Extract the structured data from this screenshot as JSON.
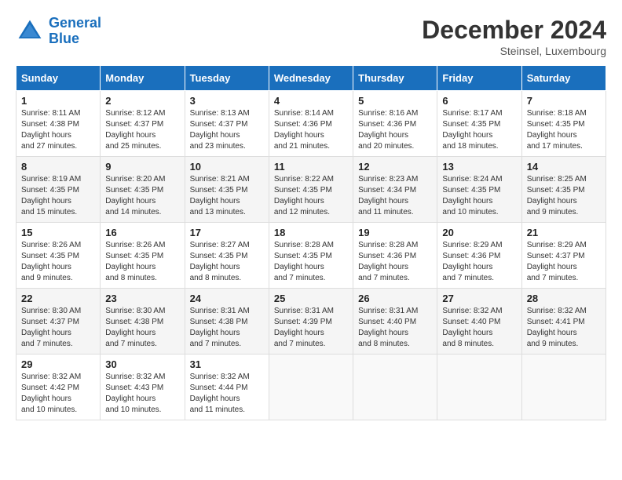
{
  "logo": {
    "line1": "General",
    "line2": "Blue"
  },
  "title": "December 2024",
  "subtitle": "Steinsel, Luxembourg",
  "days_header": [
    "Sunday",
    "Monday",
    "Tuesday",
    "Wednesday",
    "Thursday",
    "Friday",
    "Saturday"
  ],
  "weeks": [
    [
      {
        "day": "1",
        "sunrise": "8:11 AM",
        "sunset": "4:38 PM",
        "daylight": "8 hours and 27 minutes."
      },
      {
        "day": "2",
        "sunrise": "8:12 AM",
        "sunset": "4:37 PM",
        "daylight": "8 hours and 25 minutes."
      },
      {
        "day": "3",
        "sunrise": "8:13 AM",
        "sunset": "4:37 PM",
        "daylight": "8 hours and 23 minutes."
      },
      {
        "day": "4",
        "sunrise": "8:14 AM",
        "sunset": "4:36 PM",
        "daylight": "8 hours and 21 minutes."
      },
      {
        "day": "5",
        "sunrise": "8:16 AM",
        "sunset": "4:36 PM",
        "daylight": "8 hours and 20 minutes."
      },
      {
        "day": "6",
        "sunrise": "8:17 AM",
        "sunset": "4:35 PM",
        "daylight": "8 hours and 18 minutes."
      },
      {
        "day": "7",
        "sunrise": "8:18 AM",
        "sunset": "4:35 PM",
        "daylight": "8 hours and 17 minutes."
      }
    ],
    [
      {
        "day": "8",
        "sunrise": "8:19 AM",
        "sunset": "4:35 PM",
        "daylight": "8 hours and 15 minutes."
      },
      {
        "day": "9",
        "sunrise": "8:20 AM",
        "sunset": "4:35 PM",
        "daylight": "8 hours and 14 minutes."
      },
      {
        "day": "10",
        "sunrise": "8:21 AM",
        "sunset": "4:35 PM",
        "daylight": "8 hours and 13 minutes."
      },
      {
        "day": "11",
        "sunrise": "8:22 AM",
        "sunset": "4:35 PM",
        "daylight": "8 hours and 12 minutes."
      },
      {
        "day": "12",
        "sunrise": "8:23 AM",
        "sunset": "4:34 PM",
        "daylight": "8 hours and 11 minutes."
      },
      {
        "day": "13",
        "sunrise": "8:24 AM",
        "sunset": "4:35 PM",
        "daylight": "8 hours and 10 minutes."
      },
      {
        "day": "14",
        "sunrise": "8:25 AM",
        "sunset": "4:35 PM",
        "daylight": "8 hours and 9 minutes."
      }
    ],
    [
      {
        "day": "15",
        "sunrise": "8:26 AM",
        "sunset": "4:35 PM",
        "daylight": "8 hours and 9 minutes."
      },
      {
        "day": "16",
        "sunrise": "8:26 AM",
        "sunset": "4:35 PM",
        "daylight": "8 hours and 8 minutes."
      },
      {
        "day": "17",
        "sunrise": "8:27 AM",
        "sunset": "4:35 PM",
        "daylight": "8 hours and 8 minutes."
      },
      {
        "day": "18",
        "sunrise": "8:28 AM",
        "sunset": "4:35 PM",
        "daylight": "8 hours and 7 minutes."
      },
      {
        "day": "19",
        "sunrise": "8:28 AM",
        "sunset": "4:36 PM",
        "daylight": "8 hours and 7 minutes."
      },
      {
        "day": "20",
        "sunrise": "8:29 AM",
        "sunset": "4:36 PM",
        "daylight": "8 hours and 7 minutes."
      },
      {
        "day": "21",
        "sunrise": "8:29 AM",
        "sunset": "4:37 PM",
        "daylight": "8 hours and 7 minutes."
      }
    ],
    [
      {
        "day": "22",
        "sunrise": "8:30 AM",
        "sunset": "4:37 PM",
        "daylight": "8 hours and 7 minutes."
      },
      {
        "day": "23",
        "sunrise": "8:30 AM",
        "sunset": "4:38 PM",
        "daylight": "8 hours and 7 minutes."
      },
      {
        "day": "24",
        "sunrise": "8:31 AM",
        "sunset": "4:38 PM",
        "daylight": "8 hours and 7 minutes."
      },
      {
        "day": "25",
        "sunrise": "8:31 AM",
        "sunset": "4:39 PM",
        "daylight": "8 hours and 7 minutes."
      },
      {
        "day": "26",
        "sunrise": "8:31 AM",
        "sunset": "4:40 PM",
        "daylight": "8 hours and 8 minutes."
      },
      {
        "day": "27",
        "sunrise": "8:32 AM",
        "sunset": "4:40 PM",
        "daylight": "8 hours and 8 minutes."
      },
      {
        "day": "28",
        "sunrise": "8:32 AM",
        "sunset": "4:41 PM",
        "daylight": "8 hours and 9 minutes."
      }
    ],
    [
      {
        "day": "29",
        "sunrise": "8:32 AM",
        "sunset": "4:42 PM",
        "daylight": "8 hours and 10 minutes."
      },
      {
        "day": "30",
        "sunrise": "8:32 AM",
        "sunset": "4:43 PM",
        "daylight": "8 hours and 10 minutes."
      },
      {
        "day": "31",
        "sunrise": "8:32 AM",
        "sunset": "4:44 PM",
        "daylight": "8 hours and 11 minutes."
      },
      null,
      null,
      null,
      null
    ]
  ]
}
